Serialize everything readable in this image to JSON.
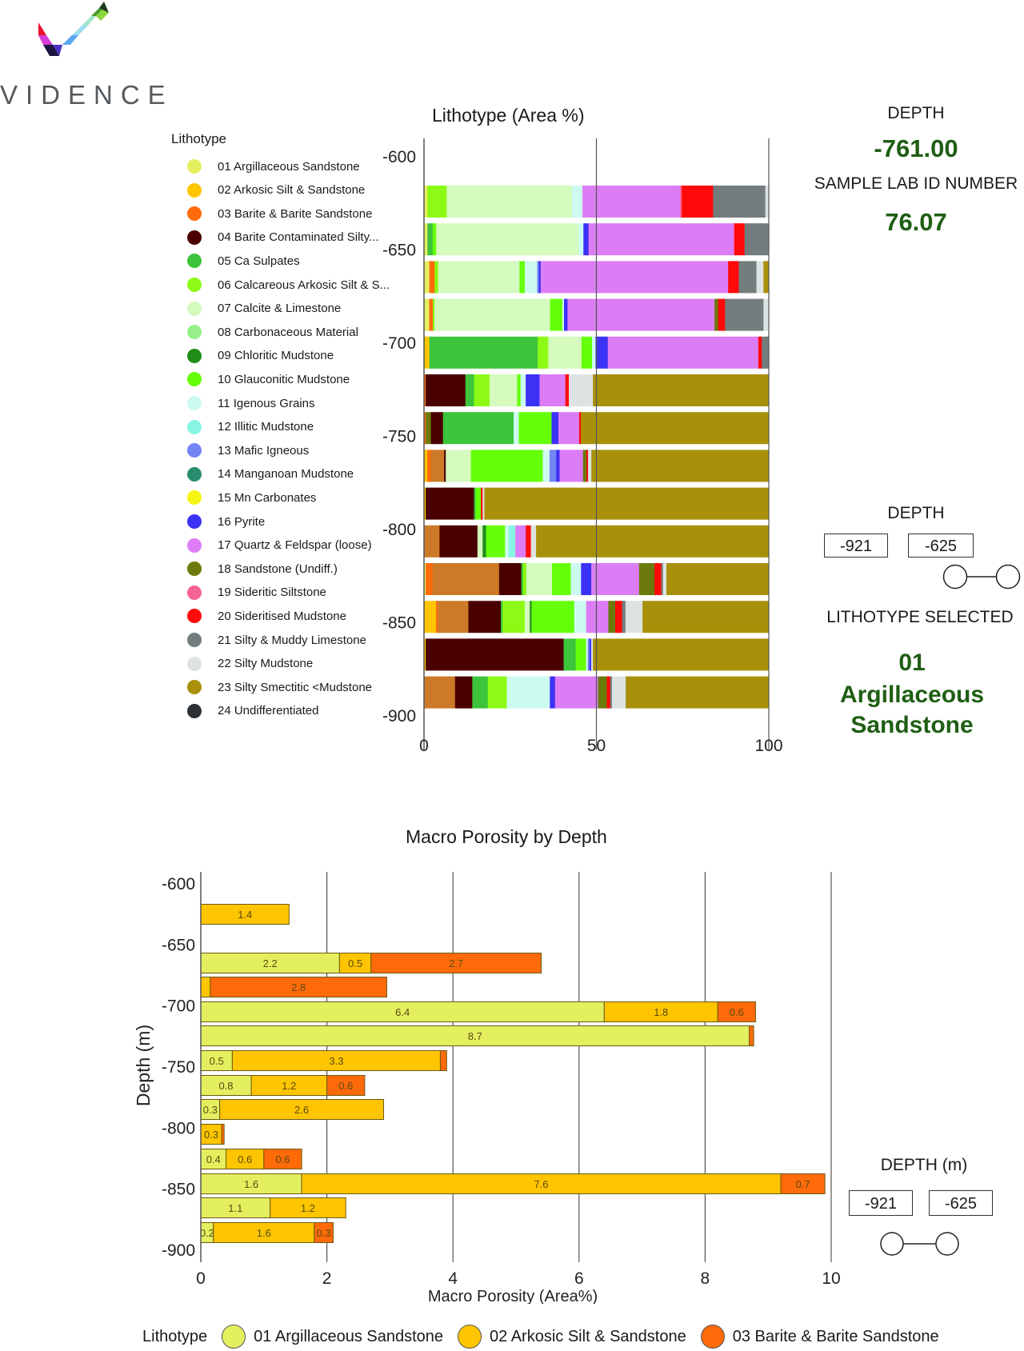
{
  "brand": {
    "name": "VIDENCE"
  },
  "legend": {
    "title": "Lithotype",
    "items": [
      {
        "label": "01  Argillaceous Sandstone",
        "color": "#e4ef5f"
      },
      {
        "label": "02  Arkosic Silt & Sandstone",
        "color": "#ffc500"
      },
      {
        "label": "03  Barite & Barite Sandstone",
        "color": "#ff6a0a"
      },
      {
        "label": "04  Barite Contaminated Silty...",
        "color": "#4a0000"
      },
      {
        "label": "05  Ca Sulpates",
        "color": "#3cc43c"
      },
      {
        "label": "06  Calcareous Arkosic Silt & S...",
        "color": "#8cfa14"
      },
      {
        "label": "07  Calcite & Limestone",
        "color": "#d4fabe"
      },
      {
        "label": "08  Carbonaceous Material",
        "color": "#96ef8c"
      },
      {
        "label": "09  Chloritic Mudstone",
        "color": "#1f8c1a"
      },
      {
        "label": "10  Glauconitic Mudstone",
        "color": "#66ff0a"
      },
      {
        "label": "11  Igenous Grains",
        "color": "#cdfaf0"
      },
      {
        "label": "12  Illitic Mudstone",
        "color": "#87f5e1"
      },
      {
        "label": "13  Mafic Igneous",
        "color": "#7384f5"
      },
      {
        "label": "14  Manganoan Mudstone",
        "color": "#2a8c6e"
      },
      {
        "label": "15  Mn Carbonates",
        "color": "#f5f514"
      },
      {
        "label": "16  Pyrite",
        "color": "#3c32f5"
      },
      {
        "label": "17  Quartz & Feldspar (loose)",
        "color": "#dc7df5"
      },
      {
        "label": "18  Sandstone (Undiff.)",
        "color": "#6b7a0a"
      },
      {
        "label": "19  Sideritic Siltstone",
        "color": "#f56496"
      },
      {
        "label": "20  Sideritised Mudstone",
        "color": "#ff0a0a"
      },
      {
        "label": "21  Silty & Muddy Limestone",
        "color": "#737d7d"
      },
      {
        "label": "22  Silty Mudstone",
        "color": "#dde3e3"
      },
      {
        "label": "23  Silty Smectitic <Mudstone",
        "color": "#a8900a"
      },
      {
        "label": "24  Undifferentiated",
        "color": "#2d3237"
      }
    ]
  },
  "info_panel": {
    "depth_label": "DEPTH",
    "depth_value": "-761.00",
    "sample_label": "SAMPLE LAB ID NUMBER",
    "sample_value": "76.07",
    "range_label": "DEPTH",
    "range_min": "-921",
    "range_max": "-625",
    "selected_label": "LITHOTYPE SELECTED",
    "selected_code": "01",
    "selected_name": "Argillaceous Sandstone"
  },
  "porosity_panel": {
    "range_label": "DEPTH (m)",
    "range_min": "-921",
    "range_max": "-625"
  },
  "chart_data": [
    {
      "type": "bar",
      "orientation": "horizontal-stacked-100",
      "title": "Lithotype (Area %)",
      "xlabel": "",
      "ylabel": "",
      "xlim": [
        0,
        100
      ],
      "ylim": [
        -600,
        -900
      ],
      "xticks": [
        "0",
        "50",
        "100"
      ],
      "yticks": [
        "-600",
        "-650",
        "-700",
        "-750",
        "-800",
        "-850",
        "-900"
      ],
      "grid": "vertical at 50, 100",
      "depths": [
        -625,
        -645,
        -665,
        -685,
        -705,
        -725,
        -745,
        -765,
        -785,
        -805,
        -825,
        -845,
        -865,
        -885
      ],
      "rows": [
        [
          [
            1,
            1
          ],
          [
            6,
            5.5
          ],
          [
            7,
            36
          ],
          [
            11,
            3
          ],
          [
            17,
            28
          ],
          [
            19,
            0.5
          ],
          [
            20,
            9
          ],
          [
            21,
            15
          ],
          [
            22,
            1
          ]
        ],
        [
          [
            1,
            1
          ],
          [
            5,
            1.5
          ],
          [
            10,
            1
          ],
          [
            7,
            41
          ],
          [
            11,
            1.5
          ],
          [
            16,
            1.5
          ],
          [
            17,
            42
          ],
          [
            20,
            3
          ],
          [
            21,
            7
          ]
        ],
        [
          [
            1,
            1.5
          ],
          [
            3,
            1.5
          ],
          [
            6,
            1
          ],
          [
            7,
            23
          ],
          [
            10,
            1.5
          ],
          [
            11,
            3.5
          ],
          [
            13,
            0.5
          ],
          [
            16,
            0.5
          ],
          [
            17,
            53
          ],
          [
            20,
            3
          ],
          [
            21,
            5
          ],
          [
            22,
            2
          ],
          [
            23,
            1.5
          ]
        ],
        [
          [
            1,
            1.5
          ],
          [
            3,
            1
          ],
          [
            6,
            0.5
          ],
          [
            7,
            33
          ],
          [
            10,
            3.5
          ],
          [
            11,
            0.5
          ],
          [
            16,
            1
          ],
          [
            17,
            42
          ],
          [
            18,
            1
          ],
          [
            20,
            2
          ],
          [
            21,
            11
          ],
          [
            22,
            1.5
          ]
        ],
        [
          [
            2,
            1.5
          ],
          [
            18,
            0
          ],
          [
            3,
            0
          ],
          [
            4,
            0
          ],
          [
            5,
            31
          ],
          [
            6,
            3
          ],
          [
            7,
            9.5
          ],
          [
            10,
            3
          ],
          [
            11,
            1
          ],
          [
            16,
            3.5
          ],
          [
            17,
            43
          ],
          [
            20,
            1
          ],
          [
            21,
            2
          ]
        ],
        [
          [
            3,
            0.5
          ],
          [
            4,
            11.5
          ],
          [
            5,
            2.5
          ],
          [
            6,
            4.5
          ],
          [
            7,
            8
          ],
          [
            10,
            1
          ],
          [
            11,
            1.5
          ],
          [
            16,
            4
          ],
          [
            17,
            7.5
          ],
          [
            20,
            1
          ],
          [
            22,
            7
          ],
          [
            23,
            51
          ]
        ],
        [
          [
            3,
            0.5
          ],
          [
            18,
            1.5
          ],
          [
            4,
            3.5
          ],
          [
            5,
            20.5
          ],
          [
            11,
            1.5
          ],
          [
            10,
            9.5
          ],
          [
            16,
            2
          ],
          [
            17,
            6
          ],
          [
            20,
            0.5
          ],
          [
            23,
            54.5
          ]
        ],
        [
          [
            2,
            1
          ],
          [
            3,
            1
          ],
          [
            18,
            4
          ],
          [
            4,
            0.5
          ],
          [
            7,
            7.5
          ],
          [
            10,
            21.5
          ],
          [
            11,
            2
          ],
          [
            13,
            2
          ],
          [
            16,
            1
          ],
          [
            17,
            7
          ],
          [
            18,
            1
          ],
          [
            20,
            0.5
          ],
          [
            22,
            1
          ],
          [
            23,
            53
          ]
        ],
        [
          [
            2,
            0.5
          ],
          [
            4,
            14
          ],
          [
            5,
            0.5
          ],
          [
            10,
            1.5
          ],
          [
            20,
            0.5
          ],
          [
            22,
            0.5
          ],
          [
            23,
            82.5
          ]
        ],
        [
          [
            18,
            4.5
          ],
          [
            4,
            11
          ],
          [
            7,
            1.5
          ],
          [
            9,
            1
          ],
          [
            10,
            5.5
          ],
          [
            11,
            1
          ],
          [
            12,
            2
          ],
          [
            17,
            3
          ],
          [
            20,
            1.5
          ],
          [
            22,
            1.5
          ],
          [
            23,
            67.5
          ]
        ],
        [
          [
            1,
            0.5
          ],
          [
            3,
            2
          ],
          [
            18,
            19.5
          ],
          [
            4,
            6.5
          ],
          [
            5,
            0.5
          ],
          [
            6,
            1
          ],
          [
            7,
            7.5
          ],
          [
            10,
            5.5
          ],
          [
            11,
            3
          ],
          [
            16,
            3
          ],
          [
            17,
            14
          ],
          [
            18,
            4.5
          ],
          [
            20,
            2
          ],
          [
            21,
            0.5
          ],
          [
            22,
            1
          ],
          [
            23,
            30
          ]
        ],
        [
          [
            2,
            3.5
          ],
          [
            3,
            0.5
          ],
          [
            18,
            9
          ],
          [
            4,
            9.5
          ],
          [
            5,
            0.5
          ],
          [
            6,
            6.5
          ],
          [
            7,
            1.5
          ],
          [
            9,
            0.5
          ],
          [
            10,
            12.5
          ],
          [
            11,
            3.5
          ],
          [
            17,
            6.5
          ],
          [
            18,
            2
          ],
          [
            20,
            2
          ],
          [
            21,
            1
          ],
          [
            22,
            5
          ],
          [
            23,
            37
          ]
        ],
        [
          [
            2,
            0.5
          ],
          [
            4,
            40
          ],
          [
            5,
            3.5
          ],
          [
            10,
            3
          ],
          [
            11,
            0.5
          ],
          [
            13,
            0.5
          ],
          [
            16,
            0.5
          ],
          [
            22,
            0.5
          ],
          [
            23,
            51
          ]
        ],
        [
          [
            18,
            9
          ],
          [
            4,
            5
          ],
          [
            5,
            4.5
          ],
          [
            6,
            5.5
          ],
          [
            11,
            12.5
          ],
          [
            16,
            1.5
          ],
          [
            17,
            12.5
          ],
          [
            18,
            2.5
          ],
          [
            20,
            1
          ],
          [
            21,
            0.5
          ],
          [
            22,
            4
          ],
          [
            23,
            41.5
          ]
        ]
      ]
    },
    {
      "type": "bar",
      "orientation": "horizontal-stacked",
      "title": "Macro Porosity by Depth",
      "xlabel": "Macro Porosity (Area%)",
      "ylabel": "Depth (m)",
      "xlim": [
        0,
        10
      ],
      "ylim": [
        -600,
        -900
      ],
      "xticks": [
        "0",
        "2",
        "4",
        "6",
        "8",
        "10"
      ],
      "yticks": [
        "-600",
        "-650",
        "-700",
        "-750",
        "-800",
        "-850",
        "-900"
      ],
      "grid": "vertical at 2, 4, 6, 8, 10",
      "legend": {
        "title": "Lithotype",
        "position": "bottom",
        "entries": [
          "01 Argillaceous Sandstone",
          "02 Arkosic Silt & Sandstone",
          "03 Barite & Barite Sandstone"
        ]
      },
      "series": [
        {
          "name": "01 Argillaceous Sandstone",
          "color": "#e4ef5f"
        },
        {
          "name": "02 Arkosic Silt & Sandstone",
          "color": "#ffc500"
        },
        {
          "name": "03 Barite & Barite Sandstone",
          "color": "#ff6a0a"
        }
      ],
      "rows": [
        {
          "depth": -625,
          "values": [
            0,
            1.4,
            0
          ],
          "labels": [
            "",
            "1.4",
            ""
          ]
        },
        {
          "depth": -665,
          "values": [
            2.2,
            0.5,
            2.7
          ],
          "labels": [
            "2.2",
            "0.5",
            "2.7"
          ]
        },
        {
          "depth": -685,
          "values": [
            0,
            0.15,
            2.8
          ],
          "labels": [
            "",
            "",
            "2.8"
          ]
        },
        {
          "depth": -705,
          "values": [
            6.4,
            1.8,
            0.6
          ],
          "labels": [
            "6.4",
            "1.8",
            "0.6"
          ]
        },
        {
          "depth": -725,
          "values": [
            8.7,
            0,
            0.07
          ],
          "labels": [
            "8.7",
            "",
            ""
          ]
        },
        {
          "depth": -745,
          "values": [
            0.5,
            3.3,
            0.1
          ],
          "labels": [
            "0.5",
            "3.3",
            ""
          ]
        },
        {
          "depth": -765,
          "values": [
            0.8,
            1.2,
            0.6
          ],
          "labels": [
            "0.8",
            "1.2",
            "0.6"
          ]
        },
        {
          "depth": -785,
          "values": [
            0.3,
            2.6,
            0
          ],
          "labels": [
            "0.3",
            "2.6",
            ""
          ]
        },
        {
          "depth": -805,
          "values": [
            0,
            0.33,
            0.04
          ],
          "labels": [
            "",
            "0.3",
            ""
          ]
        },
        {
          "depth": -825,
          "values": [
            0.4,
            0.6,
            0.6
          ],
          "labels": [
            "0.4",
            "0.6",
            "0.6"
          ]
        },
        {
          "depth": -845,
          "values": [
            1.6,
            7.6,
            0.7
          ],
          "labels": [
            "1.6",
            "7.6",
            "0.7"
          ]
        },
        {
          "depth": -865,
          "values": [
            1.1,
            1.2,
            0
          ],
          "labels": [
            "1.1",
            "1.2",
            ""
          ]
        },
        {
          "depth": -885,
          "values": [
            0.2,
            1.6,
            0.3
          ],
          "labels": [
            "0.2",
            "1.6",
            "0.3"
          ]
        }
      ]
    }
  ]
}
